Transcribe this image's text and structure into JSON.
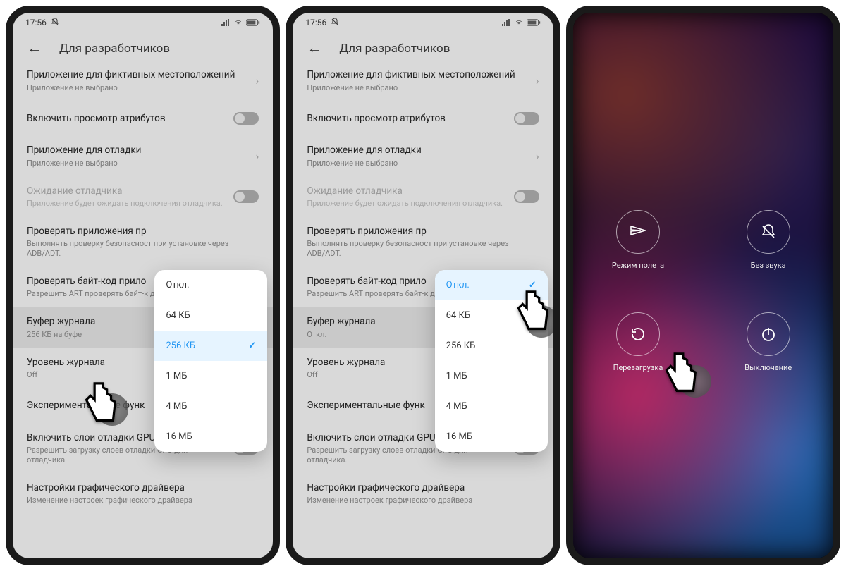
{
  "status": {
    "time": "17:56"
  },
  "header": {
    "title": "Для разработчиков"
  },
  "rows": {
    "mockloc": {
      "title": "Приложение для фиктивных местоположений",
      "sub": "Приложение не выбрано"
    },
    "attrs": {
      "title": "Включить просмотр атрибутов"
    },
    "debugapp": {
      "title": "Приложение для отладки",
      "sub": "Приложение не выбрано"
    },
    "waitdbg": {
      "title": "Ожидание отладчика",
      "sub": "Приложение будет ожидать подключения отладчика."
    },
    "verify": {
      "title": "Проверять приложения пр",
      "sub": "Выполнять проверку безопасност\nпри установке через ADB/ADT."
    },
    "bytecode": {
      "title": "Проверять байт-код прило",
      "sub": "Разрешить ART проверять байт-к доступных для отладки"
    },
    "buffer_a": {
      "title": "Буфер журнала",
      "sub": "256 КБ на буфе"
    },
    "buffer_b": {
      "title": "Буфер журнала",
      "sub": "Откл."
    },
    "loglevel": {
      "title": "Уровень журнала",
      "sub": "Off"
    },
    "exper": {
      "title": "Экспериментальные функ"
    },
    "gpudbg": {
      "title": "Включить слои отладки GPU",
      "sub": "Разрешить загрузку слоев отладки GPU для отладчика."
    },
    "gpudrv": {
      "title": "Настройки графического драйвера",
      "sub": "Изменение настроек графического драйвера"
    }
  },
  "popup": {
    "opts": [
      "Откл.",
      "64 КБ",
      "256 КБ",
      "1 МБ",
      "4 МБ",
      "16 МБ"
    ],
    "selected_a": 2,
    "selected_b": 0
  },
  "power": {
    "airplane": "Режим полета",
    "silent": "Без звука",
    "reboot": "Перезагрузка",
    "shutdown": "Выключение"
  }
}
